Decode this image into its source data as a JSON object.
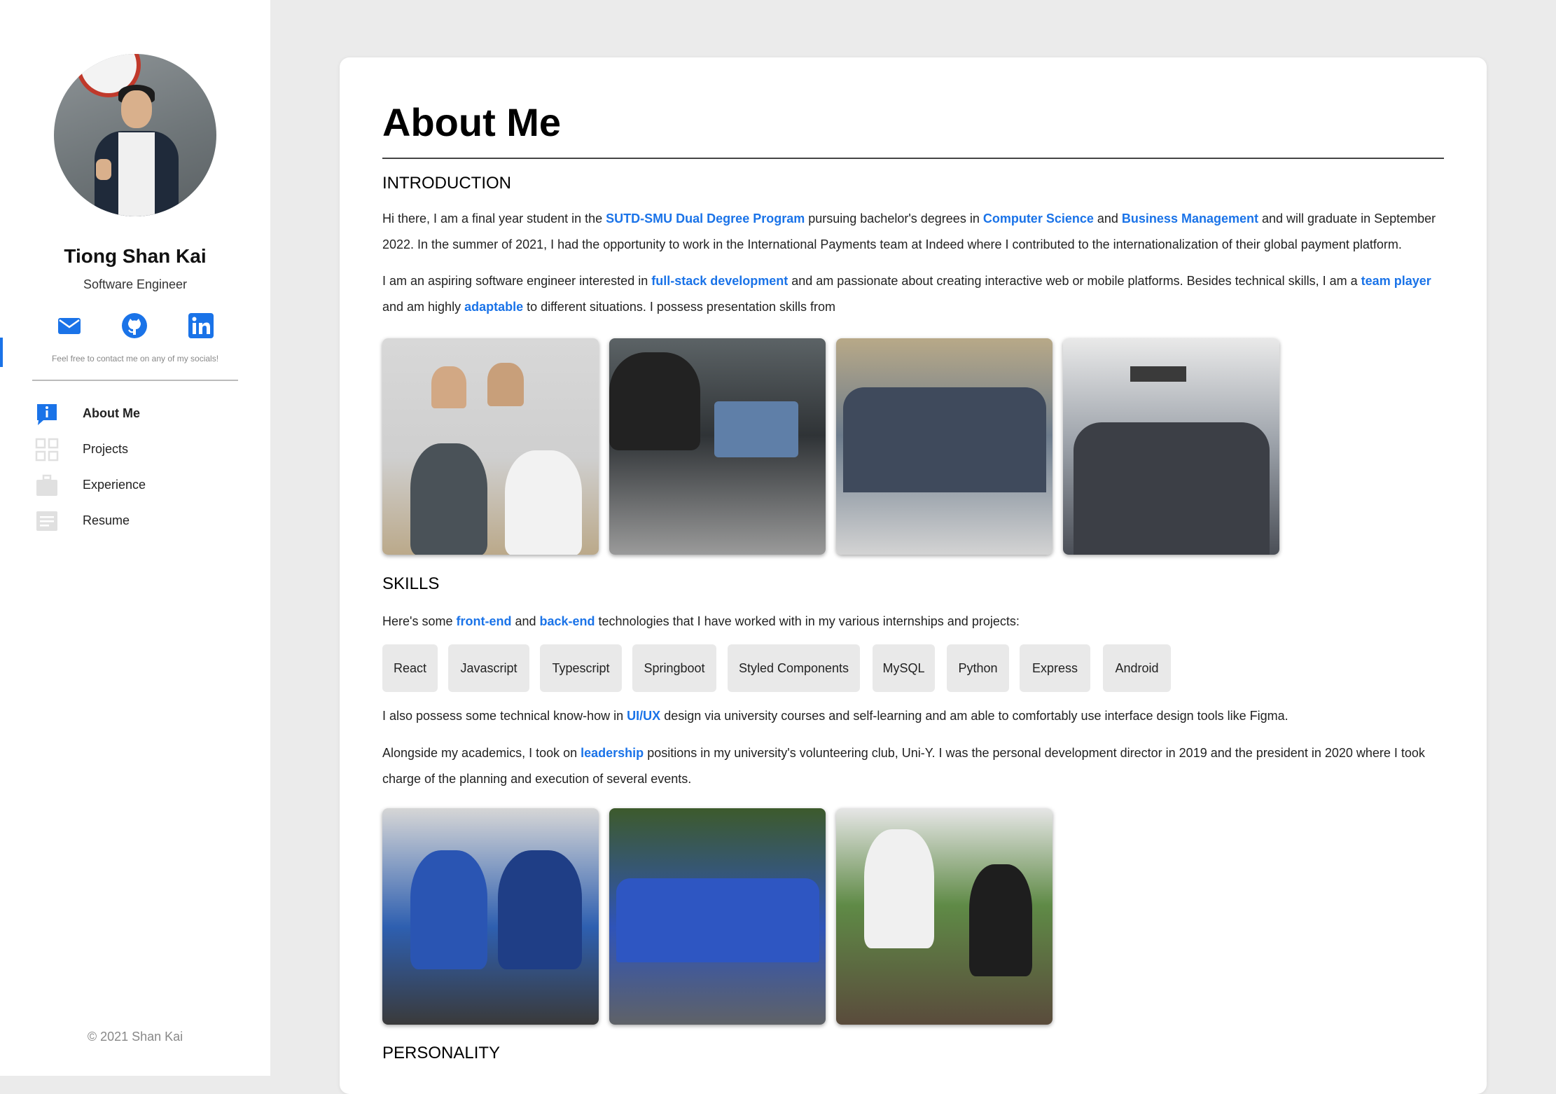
{
  "sidebar": {
    "name": "Tiong Shan Kai",
    "role": "Software Engineer",
    "socials": [
      {
        "label": "Email",
        "icon": "mail-icon"
      },
      {
        "label": "GitHub",
        "icon": "github-icon"
      },
      {
        "label": "LinkedIn",
        "icon": "linkedin-icon"
      }
    ],
    "contact_note": "Feel free to contact me on any of my socials!",
    "nav": [
      {
        "label": "About Me",
        "icon": "info-icon",
        "active": true
      },
      {
        "label": "Projects",
        "icon": "grid-icon",
        "active": false
      },
      {
        "label": "Experience",
        "icon": "briefcase-icon",
        "active": false
      },
      {
        "label": "Resume",
        "icon": "document-icon",
        "active": false
      }
    ],
    "footer": "© 2021 Shan Kai"
  },
  "colors": {
    "accent": "#1a73e8",
    "background": "#ebebeb",
    "card": "#ffffff",
    "chip": "#e9e9e9"
  },
  "main": {
    "title": "About Me",
    "sections": {
      "introduction": {
        "heading": "INTRODUCTION",
        "p1": {
          "t1": "Hi there, I am a final year student in the ",
          "h1": "SUTD-SMU Dual Degree Program",
          "t2": " pursuing bachelor's degrees in ",
          "h2": "Computer Science",
          "t3": " and ",
          "h3": "Business Management",
          "t4": " and will graduate in September 2022. In the summer of 2021, I had the opportunity to work in the International Payments team at Indeed where I contributed to the internationalization of their global payment platform."
        },
        "p2": {
          "t1": "I am an aspiring software engineer interested in ",
          "h1": "full-stack development",
          "t2": " and am passionate about creating interactive web or mobile platforms. Besides technical skills, I am a ",
          "h2": "team player",
          "t3": " and am highly ",
          "h3": "adaptable",
          "t4": " to different situations. I possess presentation skills from"
        }
      },
      "skills": {
        "heading": "SKILLS",
        "p1": {
          "t1": "Here's some ",
          "h1": "front-end",
          "t2": " and ",
          "h2": "back-end",
          "t3": " technologies that I have worked with in my various internships and projects:"
        },
        "chips": [
          "React",
          "Javascript",
          "Typescript",
          "Springboot",
          "Styled Components",
          "MySQL",
          "Python",
          "Express",
          "Android"
        ],
        "p2": {
          "t1": "I also possess some technical know-how in ",
          "h1": "UI/UX",
          "t2": " design via university courses and self-learning and am able to comfortably use interface design tools like Figma."
        },
        "p3": {
          "t1": "Alongside my academics, I took on ",
          "h1": "leadership",
          "t2": " positions in my university's volunteering club, Uni-Y. I was the personal development director in 2019 and the president in 2020 where I took charge of the planning and execution of several events."
        }
      },
      "personality": {
        "heading": "PERSONALITY"
      }
    }
  }
}
